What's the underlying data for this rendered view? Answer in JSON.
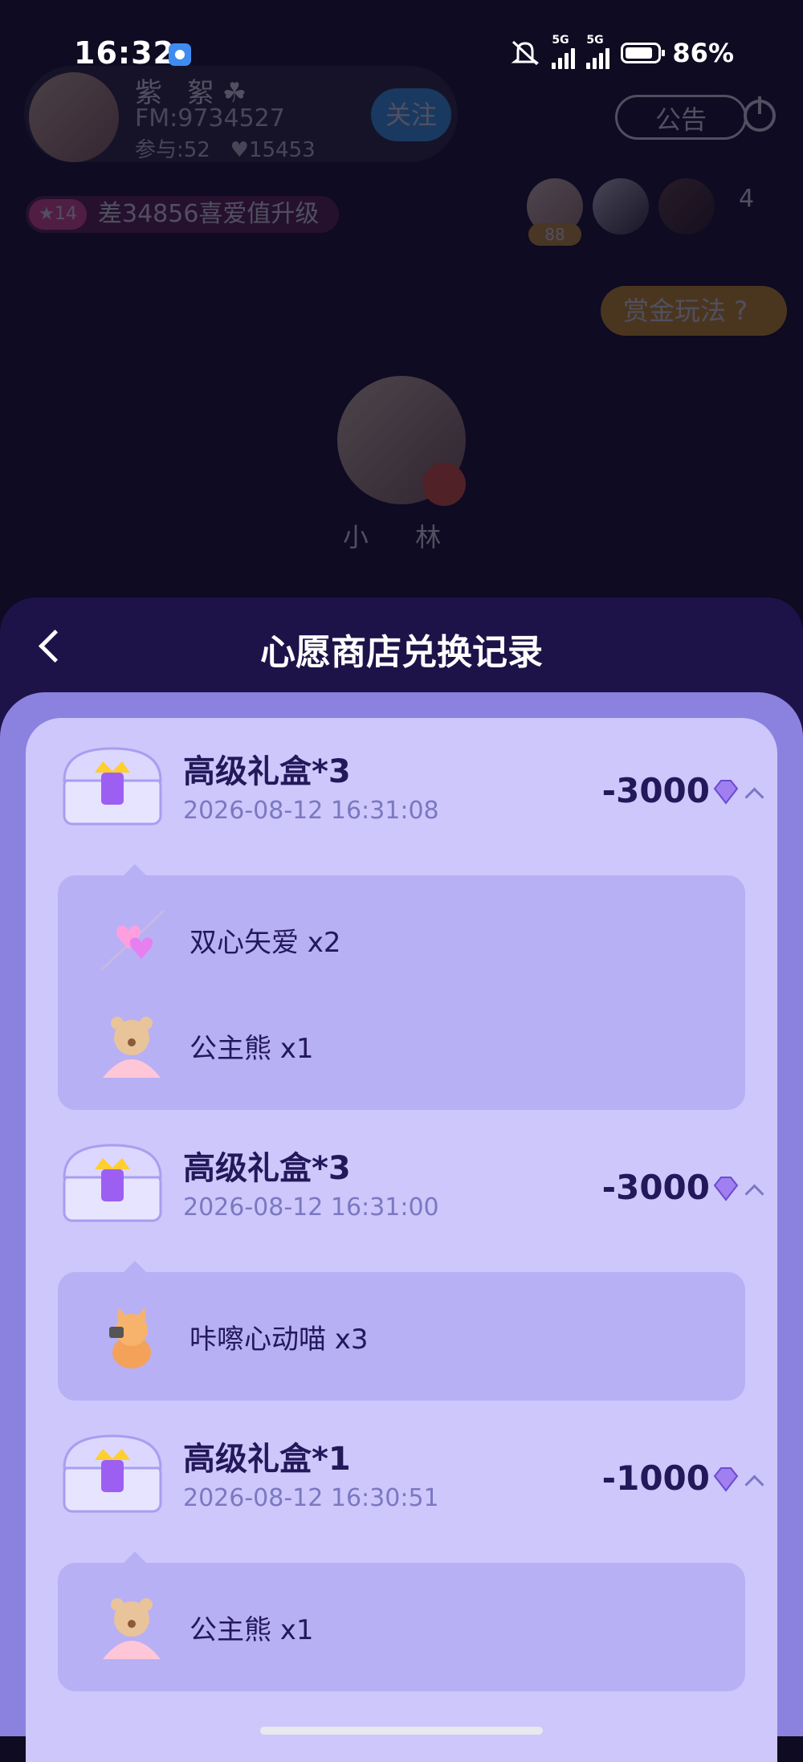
{
  "status_bar": {
    "time": "16:32",
    "battery": "86%",
    "network1": "5G",
    "network2": "5G"
  },
  "room": {
    "host_name": "紫 絮☘",
    "host_fm": "FM:9734527",
    "participants": "参与:52",
    "likes": "♥15453",
    "follow_label": "关注",
    "notice_label": "公告",
    "level_badge": "★14",
    "level_text": "差34856喜爱值升级",
    "rank_badge": "88",
    "viewer_count": "4",
    "bounty_label": "赏金玩法 ?",
    "mic_user_name": "小 林"
  },
  "sheet": {
    "title": "心愿商店兑换记录"
  },
  "records": [
    {
      "name": "高级礼盒*3",
      "date": "2026-08-12 16:31:08",
      "amount": "-3000",
      "items": [
        {
          "text": "双心矢爱 x2",
          "icon": "heart-arrow-icon"
        },
        {
          "text": "公主熊 x1",
          "icon": "princess-bear-icon"
        }
      ]
    },
    {
      "name": "高级礼盒*3",
      "date": "2026-08-12 16:31:00",
      "amount": "-3000",
      "items": [
        {
          "text": "咔嚓心动喵 x3",
          "icon": "camera-cat-icon"
        }
      ]
    },
    {
      "name": "高级礼盒*1",
      "date": "2026-08-12 16:30:51",
      "amount": "-1000",
      "items": [
        {
          "text": "公主熊 x1",
          "icon": "princess-bear-icon"
        }
      ]
    }
  ],
  "colors": {
    "sheet_bg": "#1d1349",
    "panel_bg": "#cdc7fb",
    "sub_panel_bg": "#b7b0f4",
    "primary_text": "#23185a",
    "date_text": "#7b78c2"
  }
}
